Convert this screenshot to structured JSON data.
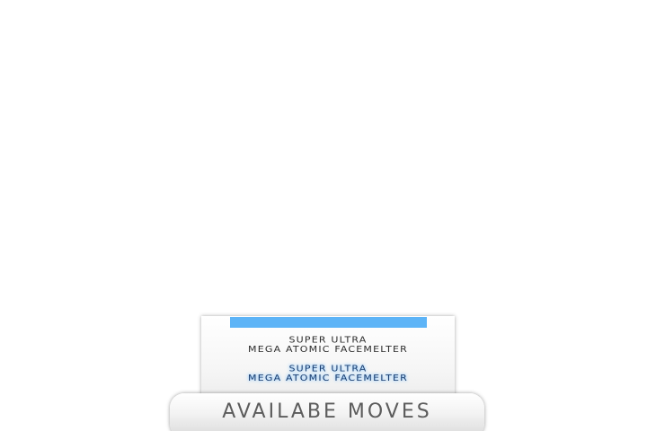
{
  "moves_menu": {
    "title": "AVAILABE MOVES",
    "moves": [
      {
        "line1": "SUPER ULTRA",
        "line2": "MEGA ATOMIC FACEMELTER",
        "highlighted": false
      },
      {
        "line1": "SUPER ULTRA",
        "line2": "MEGA ATOMIC FACEMELTER",
        "highlighted": true
      }
    ]
  },
  "colors": {
    "selection_bar": "#5db4f7",
    "highlight_glow": "#8fc9ff",
    "text_dark": "#2c2c2c",
    "title_text": "#5c5c5c"
  }
}
